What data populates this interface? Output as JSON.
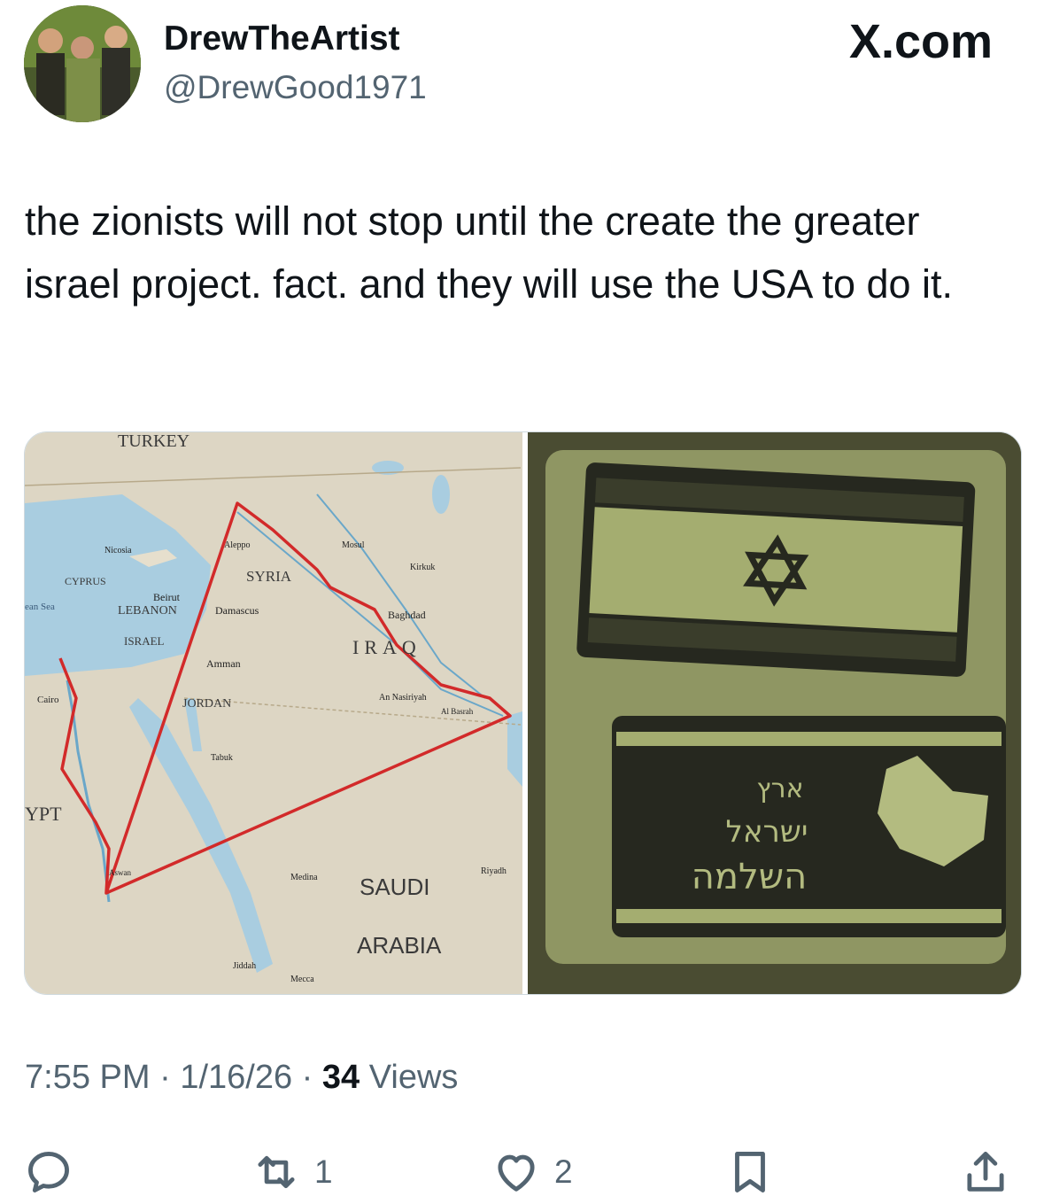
{
  "author": {
    "display_name": "DrewTheArtist",
    "handle": "@DrewGood1971"
  },
  "site_label": "X.com",
  "tweet": {
    "text": "the zionists will not stop until the create the greater israel project. fact. and they will use the USA to do it."
  },
  "media": {
    "map_labels": {
      "turkey": "TURKEY",
      "syria": "SYRIA",
      "iraq": "IRAQ",
      "jordan": "JORDAN",
      "lebanon": "LEBANON",
      "israel": "ISRAEL",
      "cyprus": "CYPRUS",
      "saudi": "SAUDI",
      "arabia": "ARABIA",
      "egypt": "YPT",
      "beirut": "Beirut",
      "damascus": "Damascus",
      "amman": "Amman",
      "baghdad": "Baghdad",
      "riyadh": "Riyadh",
      "medina": "Medina",
      "mecca": "Mecca",
      "jiddah": "Jiddah",
      "cairo": "Cairo",
      "aswan": "Aswan",
      "nicosia": "Nicosia",
      "mosul": "Mosul",
      "kirkuk": "Kirkuk",
      "tabuk": "Tabuk",
      "aleppo": "Aleppo",
      "an_nasiriyah": "An Nasiriyah",
      "al_basrah": "Al Basrah",
      "sea": "ean Sea"
    },
    "patch_text": {
      "line1": "ארץ",
      "line2": "ישראל",
      "line3": "השלמה"
    }
  },
  "meta": {
    "time": "7:55 PM",
    "sep1": "·",
    "date": "1/16/26",
    "sep2": "·",
    "views_count": "34",
    "views_label": "Views"
  },
  "actions": {
    "reply_count": "",
    "retweet_count": "1",
    "like_count": "2"
  },
  "colors": {
    "accent_text": "#0f1419",
    "secondary_text": "#536471",
    "border": "#cfd9de"
  }
}
